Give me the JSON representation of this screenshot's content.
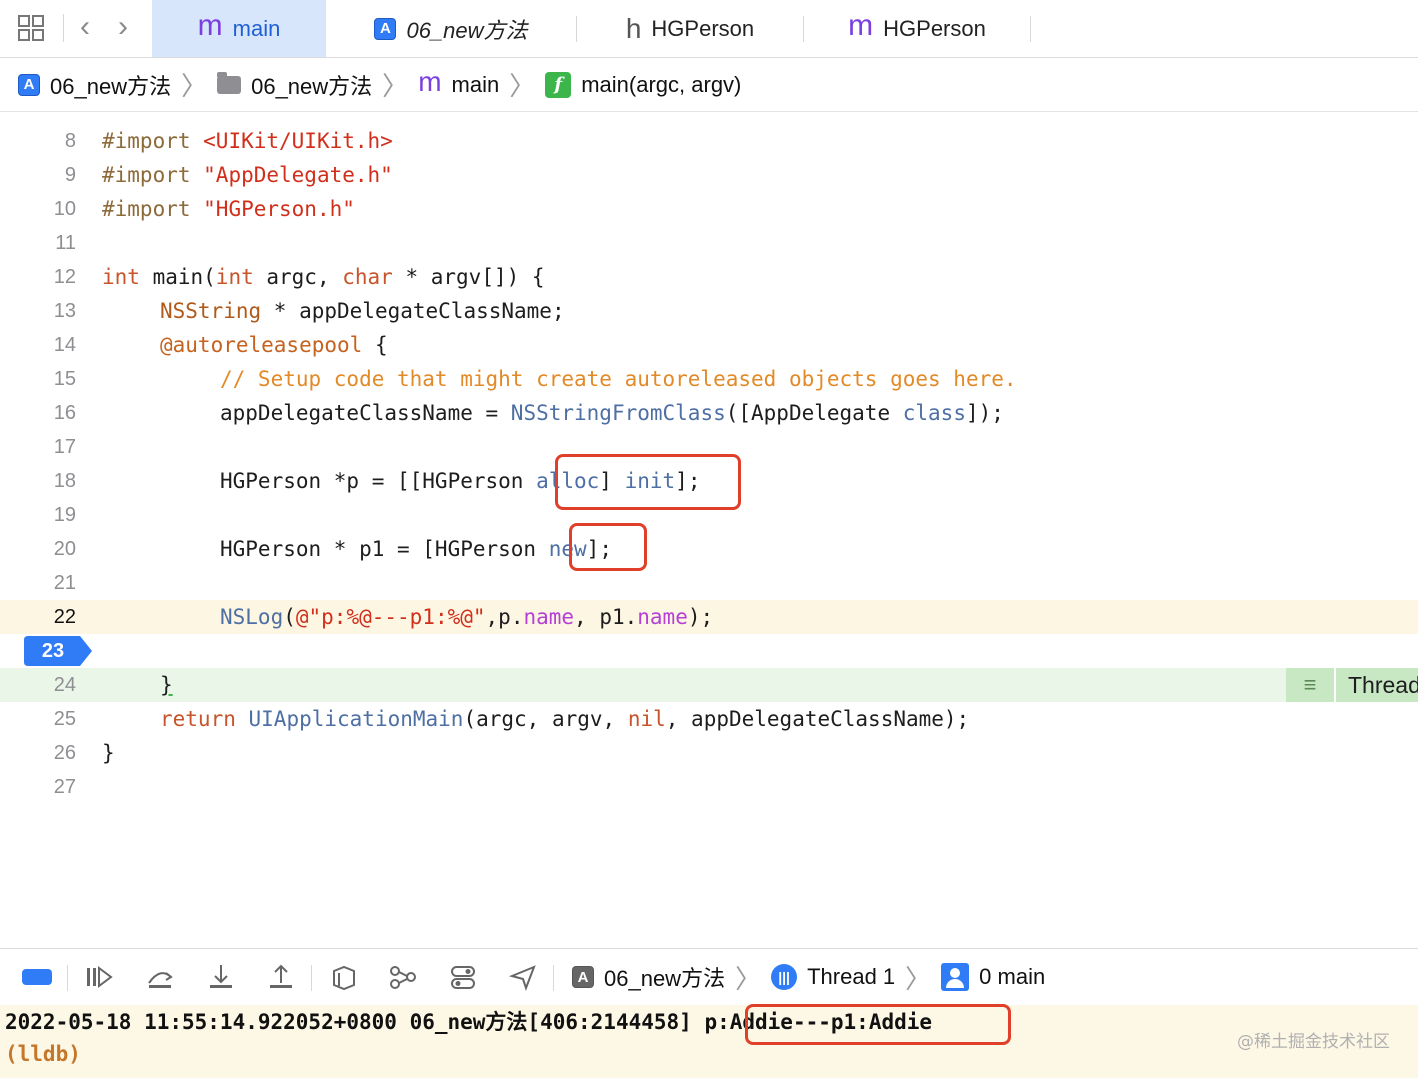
{
  "tabs": [
    {
      "label": "main",
      "icon": "m-icon",
      "active": true
    },
    {
      "label": "06_new方法",
      "icon": "xcode-app-icon",
      "active": false
    },
    {
      "label": "HGPerson",
      "icon": "h-icon",
      "active": false
    },
    {
      "label": "HGPerson",
      "icon": "m-icon",
      "active": false
    }
  ],
  "breadcrumb": [
    "06_new方法",
    "06_new方法",
    "main",
    "main(argc, argv)"
  ],
  "lines": [
    {
      "n": "8"
    },
    {
      "n": "9"
    },
    {
      "n": "10"
    },
    {
      "n": "11"
    },
    {
      "n": "12"
    },
    {
      "n": "13"
    },
    {
      "n": "14"
    },
    {
      "n": "15"
    },
    {
      "n": "16"
    },
    {
      "n": "17"
    },
    {
      "n": "18"
    },
    {
      "n": "19"
    },
    {
      "n": "20"
    },
    {
      "n": "21"
    },
    {
      "n": "22"
    },
    {
      "n": "23"
    },
    {
      "n": "24"
    },
    {
      "n": "25"
    },
    {
      "n": "26"
    },
    {
      "n": "27"
    }
  ],
  "code": {
    "l8": {
      "a": "#import ",
      "b": "<UIKit/UIKit.h>"
    },
    "l9": {
      "a": "#import ",
      "b": "\"AppDelegate.h\""
    },
    "l10": {
      "a": "#import ",
      "b": "\"HGPerson.h\""
    },
    "l12": {
      "a": "int",
      "b": " main(",
      "c": "int",
      "d": " argc, ",
      "e": "char",
      "f": " * argv[]) {"
    },
    "l13": {
      "a": "NSString",
      "b": " * appDelegateClassName;"
    },
    "l14": {
      "a": "@autoreleasepool",
      "b": " {"
    },
    "l15": {
      "a": "// Setup code that might create autoreleased objects goes here."
    },
    "l16": {
      "a": "appDelegateClassName = ",
      "b": "NSStringFromClass",
      "c": "([AppDelegate ",
      "d": "class",
      "e": "]);"
    },
    "l18": {
      "a": "HGPerson *p = [[HGPerson ",
      "b": "alloc",
      "c": "] ",
      "d": "init",
      "e": "];"
    },
    "l20": {
      "a": "HGPerson * p1 = [HGPerson ",
      "b": "new",
      "c": "];"
    },
    "l22": {
      "a": "NSLog",
      "b": "(",
      "c": "@\"p:%@---p1:%@\"",
      "d": ",p.",
      "e": "name",
      "f": ", p1.",
      "g": "name",
      "h": ");"
    },
    "l24": {
      "a": "}"
    },
    "l25": {
      "a": "return",
      "b": " ",
      "c": "UIApplicationMain",
      "d": "(argc, argv, ",
      "e": "nil",
      "f": ", appDelegateClassName);"
    },
    "l26": {
      "a": "}"
    }
  },
  "thread_badge": {
    "label": "Thread"
  },
  "debug_bar": {
    "target": "06_new方法",
    "thread": "Thread 1",
    "frame": "0 main"
  },
  "console": {
    "log_prefix": "2022-05-18 11:55:14.922052+0800 06_new方法[406:2144458] ",
    "log_output": "p:Addie---p1:Addie",
    "prompt": "(lldb)"
  },
  "watermark": "@稀土掘金技术社区",
  "colors": {
    "accent": "#2f7cf6",
    "highlight_box": "#e0402a",
    "exec_line": "#fdf6e3",
    "current_line": "#eaf6e8"
  }
}
